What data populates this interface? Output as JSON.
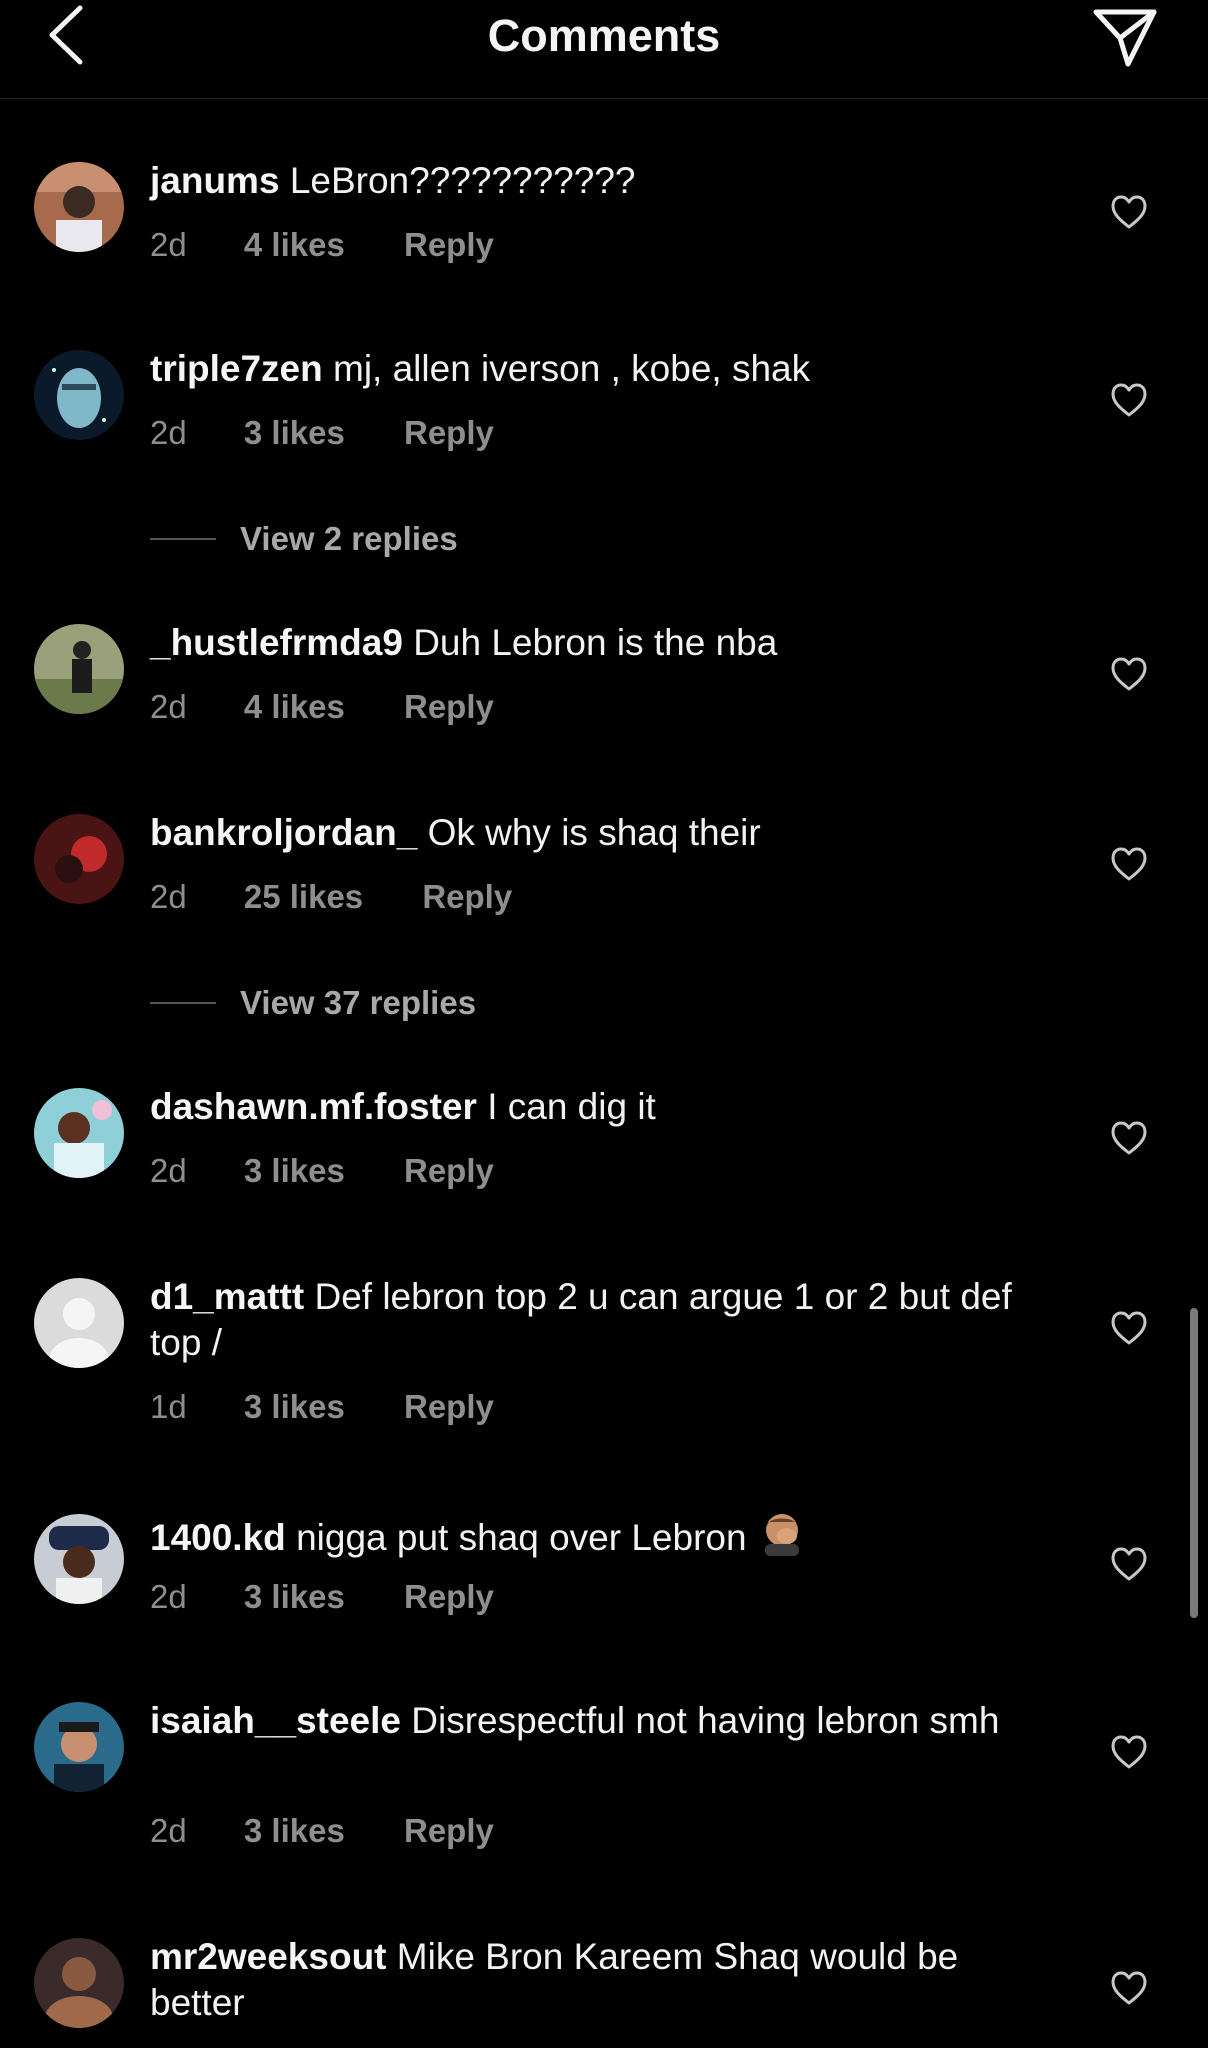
{
  "header": {
    "title": "Comments"
  },
  "comments": [
    {
      "username": "janums",
      "text": "LeBron???????????",
      "time": "2d",
      "likes": "4 likes",
      "reply_label": "Reply"
    },
    {
      "username": "triple7zen",
      "text": "mj, allen iverson , kobe, shak",
      "time": "2d",
      "likes": "3 likes",
      "reply_label": "Reply",
      "view_replies": "View 2 replies"
    },
    {
      "username": "_hustlefrmda9",
      "text": "Duh Lebron is the nba",
      "time": "2d",
      "likes": "4 likes",
      "reply_label": "Reply"
    },
    {
      "username": "bankroljordan_",
      "text": "Ok why is shaq their",
      "time": "2d",
      "likes": "25 likes",
      "reply_label": "Reply",
      "view_replies": "View 37 replies"
    },
    {
      "username": "dashawn.mf.foster",
      "text": "I can dig it",
      "time": "2d",
      "likes": "3 likes",
      "reply_label": "Reply"
    },
    {
      "username": "d1_mattt",
      "text": "Def lebron top 2 u can argue 1 or 2 but def top /",
      "time": "1d",
      "likes": "3 likes",
      "reply_label": "Reply"
    },
    {
      "username": "1400.kd",
      "text": "nigga put shaq over Lebron",
      "emoji": "face-palm-emoji",
      "time": "2d",
      "likes": "3 likes",
      "reply_label": "Reply"
    },
    {
      "username": "isaiah__steele",
      "text": "Disrespectful not having lebron smh",
      "time": "2d",
      "likes": "3 likes",
      "reply_label": "Reply"
    },
    {
      "username": "mr2weeksout",
      "text": "Mike Bron Kareem Shaq would be better"
    }
  ],
  "icons": {
    "back": "chevron-left-icon",
    "share": "paper-plane-icon",
    "like": "heart-outline-icon"
  },
  "colors": {
    "background": "#000000",
    "text": "#f5f5f5",
    "secondary": "#8e8e8e",
    "divider": "#262626"
  }
}
